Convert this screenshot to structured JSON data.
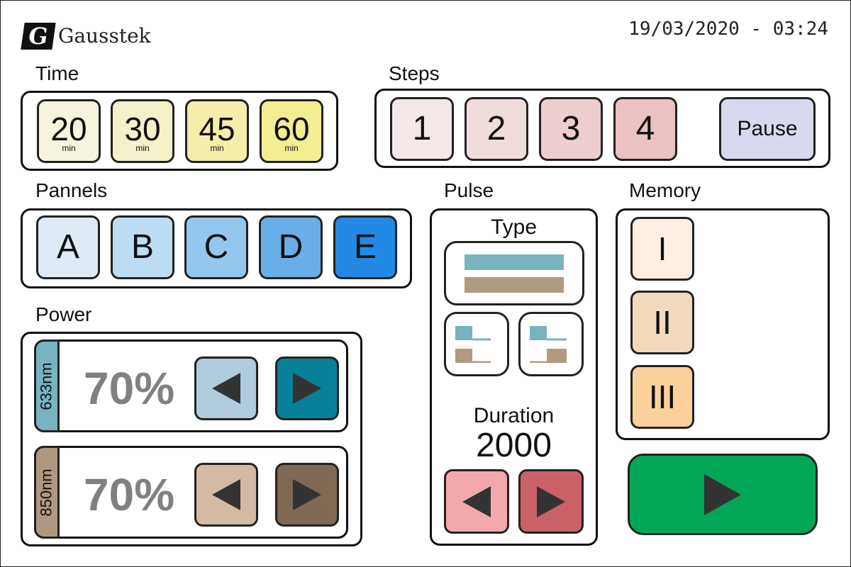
{
  "header": {
    "logo_mark": "G",
    "brand": "Gausstek",
    "datetime": "19/03/2020 - 03:24"
  },
  "time": {
    "label": "Time",
    "buttons": [
      {
        "value": "20",
        "unit": "min",
        "color": "#f6f4df"
      },
      {
        "value": "30",
        "unit": "min",
        "color": "#f4f1c8"
      },
      {
        "value": "45",
        "unit": "min",
        "color": "#f4eeaa"
      },
      {
        "value": "60",
        "unit": "min",
        "color": "#f2ee91"
      }
    ]
  },
  "steps": {
    "label": "Steps",
    "buttons": [
      {
        "label": "1",
        "color": "#f4e8e8"
      },
      {
        "label": "2",
        "color": "#f1dcdc"
      },
      {
        "label": "3",
        "color": "#edcece"
      },
      {
        "label": "4",
        "color": "#ebc1c1"
      }
    ],
    "pause_label": "Pause",
    "pause_color": "#d7d9ee"
  },
  "pannels": {
    "label": "Pannels",
    "buttons": [
      {
        "label": "A",
        "color": "#deebf7"
      },
      {
        "label": "B",
        "color": "#bcdcf4"
      },
      {
        "label": "C",
        "color": "#94c7ee"
      },
      {
        "label": "D",
        "color": "#6aaee8"
      },
      {
        "label": "E",
        "color": "#2289e6"
      }
    ]
  },
  "power": {
    "label": "Power",
    "rows": [
      {
        "wavelength": "633nm",
        "percent": "70%",
        "tab_color": "#77b3c0",
        "down_color": "#b0cbdb",
        "up_color": "#07809a",
        "left_icon": "left-arrow-icon",
        "right_icon": "right-arrow-icon"
      },
      {
        "wavelength": "850nm",
        "percent": "70%",
        "tab_color": "#b09880",
        "down_color": "#d3baa2",
        "up_color": "#7f6854",
        "left_icon": "left-arrow-icon",
        "right_icon": "right-arrow-icon"
      }
    ]
  },
  "pulse": {
    "label": "Pulse",
    "type_label": "Type",
    "duration_label": "Duration",
    "duration_value": "2000",
    "colors": {
      "teal": "#78b3bf",
      "brown": "#b19a82",
      "down": "#f3a8ad",
      "up": "#cb6168"
    }
  },
  "memory": {
    "label": "Memory",
    "buttons": [
      {
        "label": "I",
        "color": "#fdf0e2"
      },
      {
        "label": "II",
        "color": "#f1dabb"
      },
      {
        "label": "III",
        "color": "#fbd09a"
      }
    ]
  },
  "start": {
    "icon": "play-icon",
    "color": "#02a657"
  }
}
